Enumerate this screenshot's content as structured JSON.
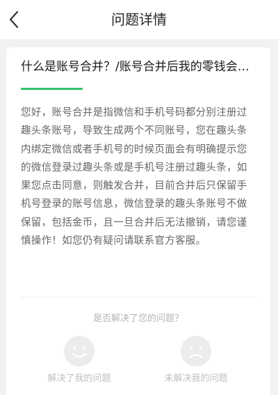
{
  "nav": {
    "title": "问题详情",
    "back_icon": "chevron-left-icon"
  },
  "question": {
    "title": "什么是账号合并？/账号合并后我的零钱会怎样？",
    "answer": "您好，账号合并是指微信和手机号码都分别注册过趣头条账号，导致生成两个不同账号，您在趣头条内绑定微信或者手机号的时候页面会有明确提示您的微信登录过趣头条或是手机号注册过趣头条，如果您点击同意，则触发合并，目前合并后只保留手机号登录的账号信息，微信登录的趣头条账号不做保留，包括金币，且一旦合并后无法撤销，请您谨慎操作！如您仍有疑问请联系官方客服。"
  },
  "feedback": {
    "prompt": "是否解决了您的问题？",
    "solved_label": "解决了我的问题",
    "solved_icon": "smile-face-icon",
    "unsolved_label": "未解决我的问题",
    "unsolved_icon": "sad-face-icon"
  },
  "colors": {
    "accent": "#2ec26b",
    "background": "#f2f2f2",
    "card": "#ffffff",
    "muted": "#c0c0c0"
  }
}
